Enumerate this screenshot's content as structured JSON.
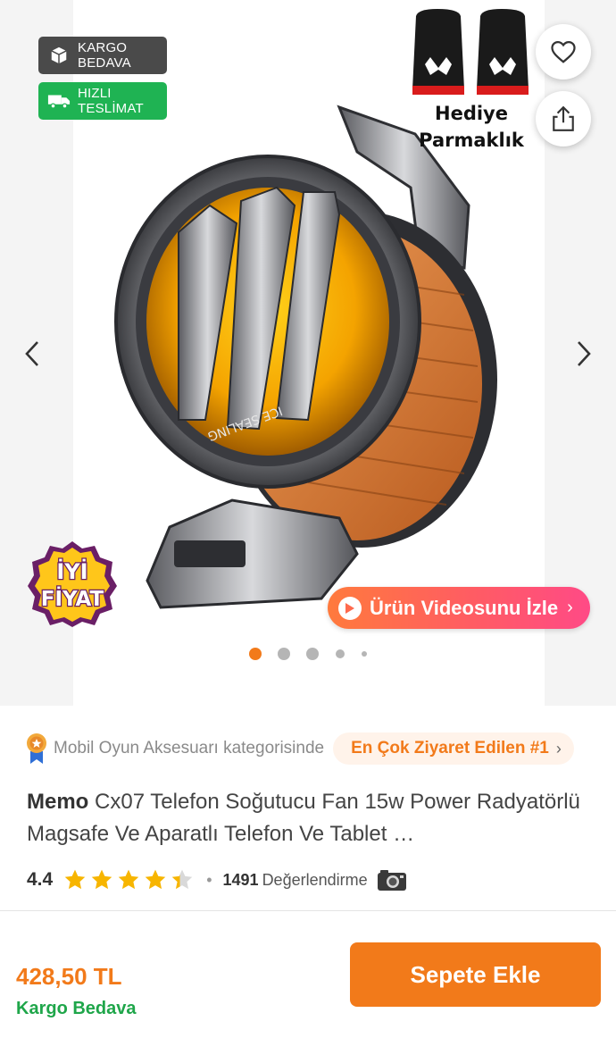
{
  "badges": {
    "kargo_line1": "KARGO",
    "kargo_line2": "BEDAVA",
    "hizli_line1": "HIZLI",
    "hizli_line2": "TESLİMAT"
  },
  "gift_text": {
    "line1": "Hediye",
    "line2": "Parmaklık"
  },
  "good_price": {
    "line1": "İYİ",
    "line2": "FİYAT"
  },
  "video_button": {
    "label": "Ürün Videosunu İzle",
    "chevron": "›"
  },
  "arrows": {
    "prev": "‹",
    "next": "›"
  },
  "gallery": {
    "active_index": 0,
    "dot_count": 5
  },
  "category": {
    "text": "Mobil Oyun Aksesuarı kategorisinde",
    "rank": "En Çok Ziyaret Edilen #1",
    "chevron": "›"
  },
  "product": {
    "brand": "Memo",
    "name": "Cx07 Telefon Soğutucu Fan 15w Power Radyatörlü Magsafe Ve Aparatlı Telefon Ve Tablet …"
  },
  "rating": {
    "value": "4.4",
    "stars": 4.4,
    "separator": "•",
    "review_count": "1491",
    "review_label": "Değerlendirme"
  },
  "bottom": {
    "price": "428,50 TL",
    "shipping": "Kargo Bedava",
    "cart_button": "Sepete Ekle"
  },
  "colors": {
    "accent": "#f27a1a",
    "green": "#1fb353",
    "badge_dark": "#4a4a4a",
    "star": "#f7b500"
  },
  "icons": {
    "favorite": "heart-icon",
    "share": "share-icon",
    "kargo": "package-icon",
    "hizli": "truck-icon",
    "video": "play-icon",
    "medal": "medal-icon",
    "photo_reviews": "camera-icon"
  }
}
